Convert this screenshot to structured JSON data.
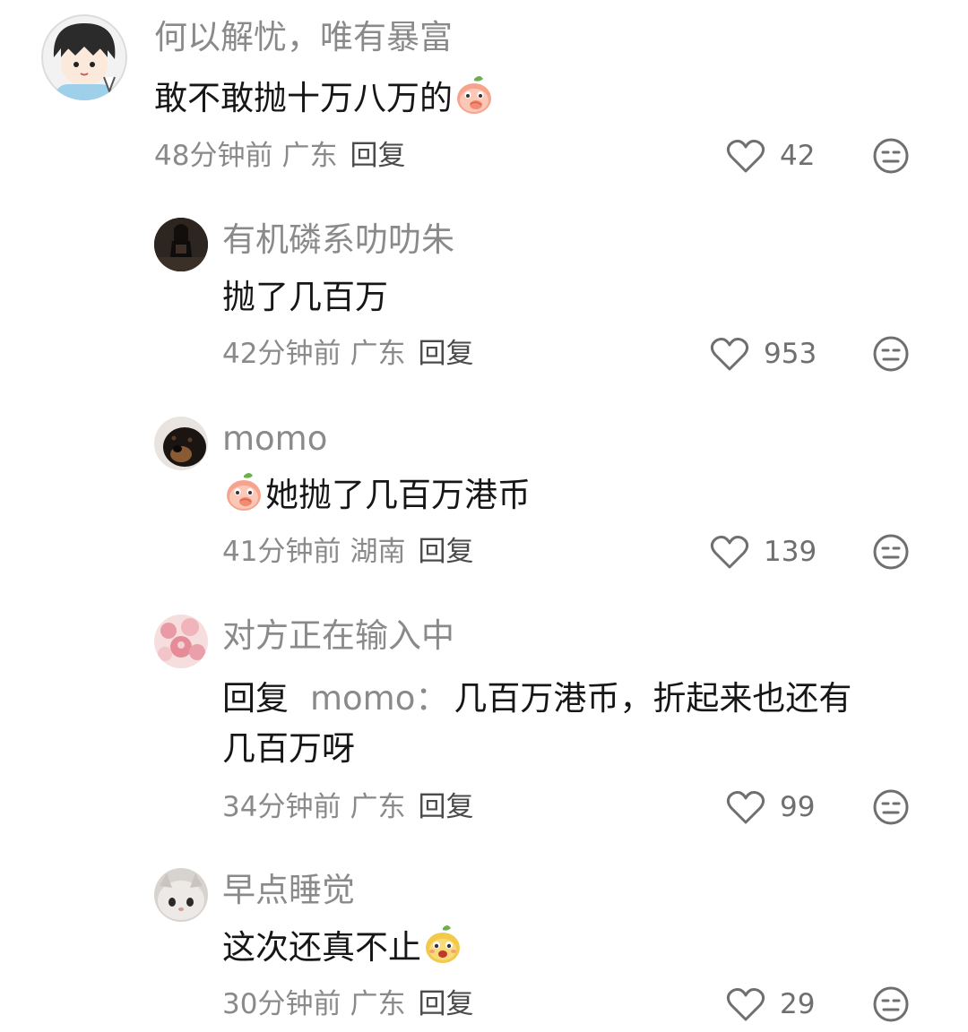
{
  "comments": [
    {
      "username": "何以解忧，唯有暴富",
      "text": "敢不敢抛十万八万的",
      "emoji": "peach-covering-mouth-emoji",
      "time": "48分钟前",
      "location": "广东",
      "reply_label": "回复",
      "likes": "42"
    },
    {
      "username": "有机磷系叻叻朱",
      "text": "抛了几百万",
      "time": "42分钟前",
      "location": "广东",
      "reply_label": "回复",
      "likes": "953"
    },
    {
      "username": "momo",
      "emoji": "peach-covering-mouth-emoji",
      "text": "她抛了几百万港币",
      "time": "41分钟前",
      "location": "湖南",
      "reply_label": "回复",
      "likes": "139"
    },
    {
      "username": "对方正在输入中",
      "reply_prefix": "回复",
      "reply_to": "momo：",
      "text_line1": "几百万港币，折起来也还有",
      "text_line2": "几百万呀",
      "time": "34分钟前",
      "location": "广东",
      "reply_label": "回复",
      "likes": "99"
    },
    {
      "username": "早点睡觉",
      "text": "这次还真不止",
      "emoji": "yellow-blob-emoji",
      "time": "30分钟前",
      "location": "广东",
      "reply_label": "回复",
      "likes": "29"
    }
  ],
  "icons": {
    "like": "heart-outline-icon",
    "dislike": "meh-face-icon"
  },
  "colors": {
    "background": "#ffffff",
    "text_primary": "#161616",
    "text_secondary": "#8a8a8a",
    "reply": "#4a4a4a"
  }
}
